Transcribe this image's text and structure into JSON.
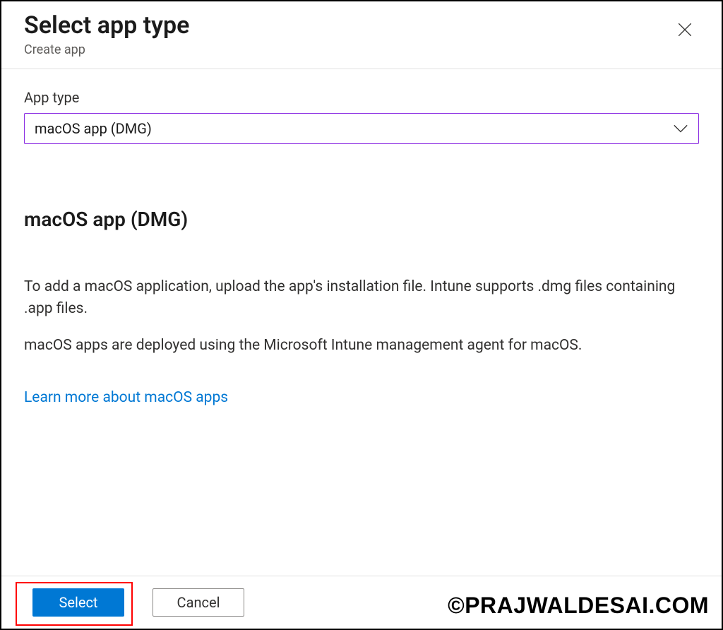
{
  "header": {
    "title": "Select app type",
    "subtitle": "Create app"
  },
  "form": {
    "app_type_label": "App type",
    "app_type_value": "macOS app (DMG)"
  },
  "details": {
    "heading": "macOS app (DMG)",
    "p1": "To add a macOS application, upload the app's installation file. Intune supports .dmg files containing .app files.",
    "p2": "macOS apps are deployed using the Microsoft Intune management agent for macOS.",
    "link_text": "Learn more about macOS apps"
  },
  "footer": {
    "select_label": "Select",
    "cancel_label": "Cancel"
  },
  "watermark": "©PRAJWALDESAI.COM"
}
